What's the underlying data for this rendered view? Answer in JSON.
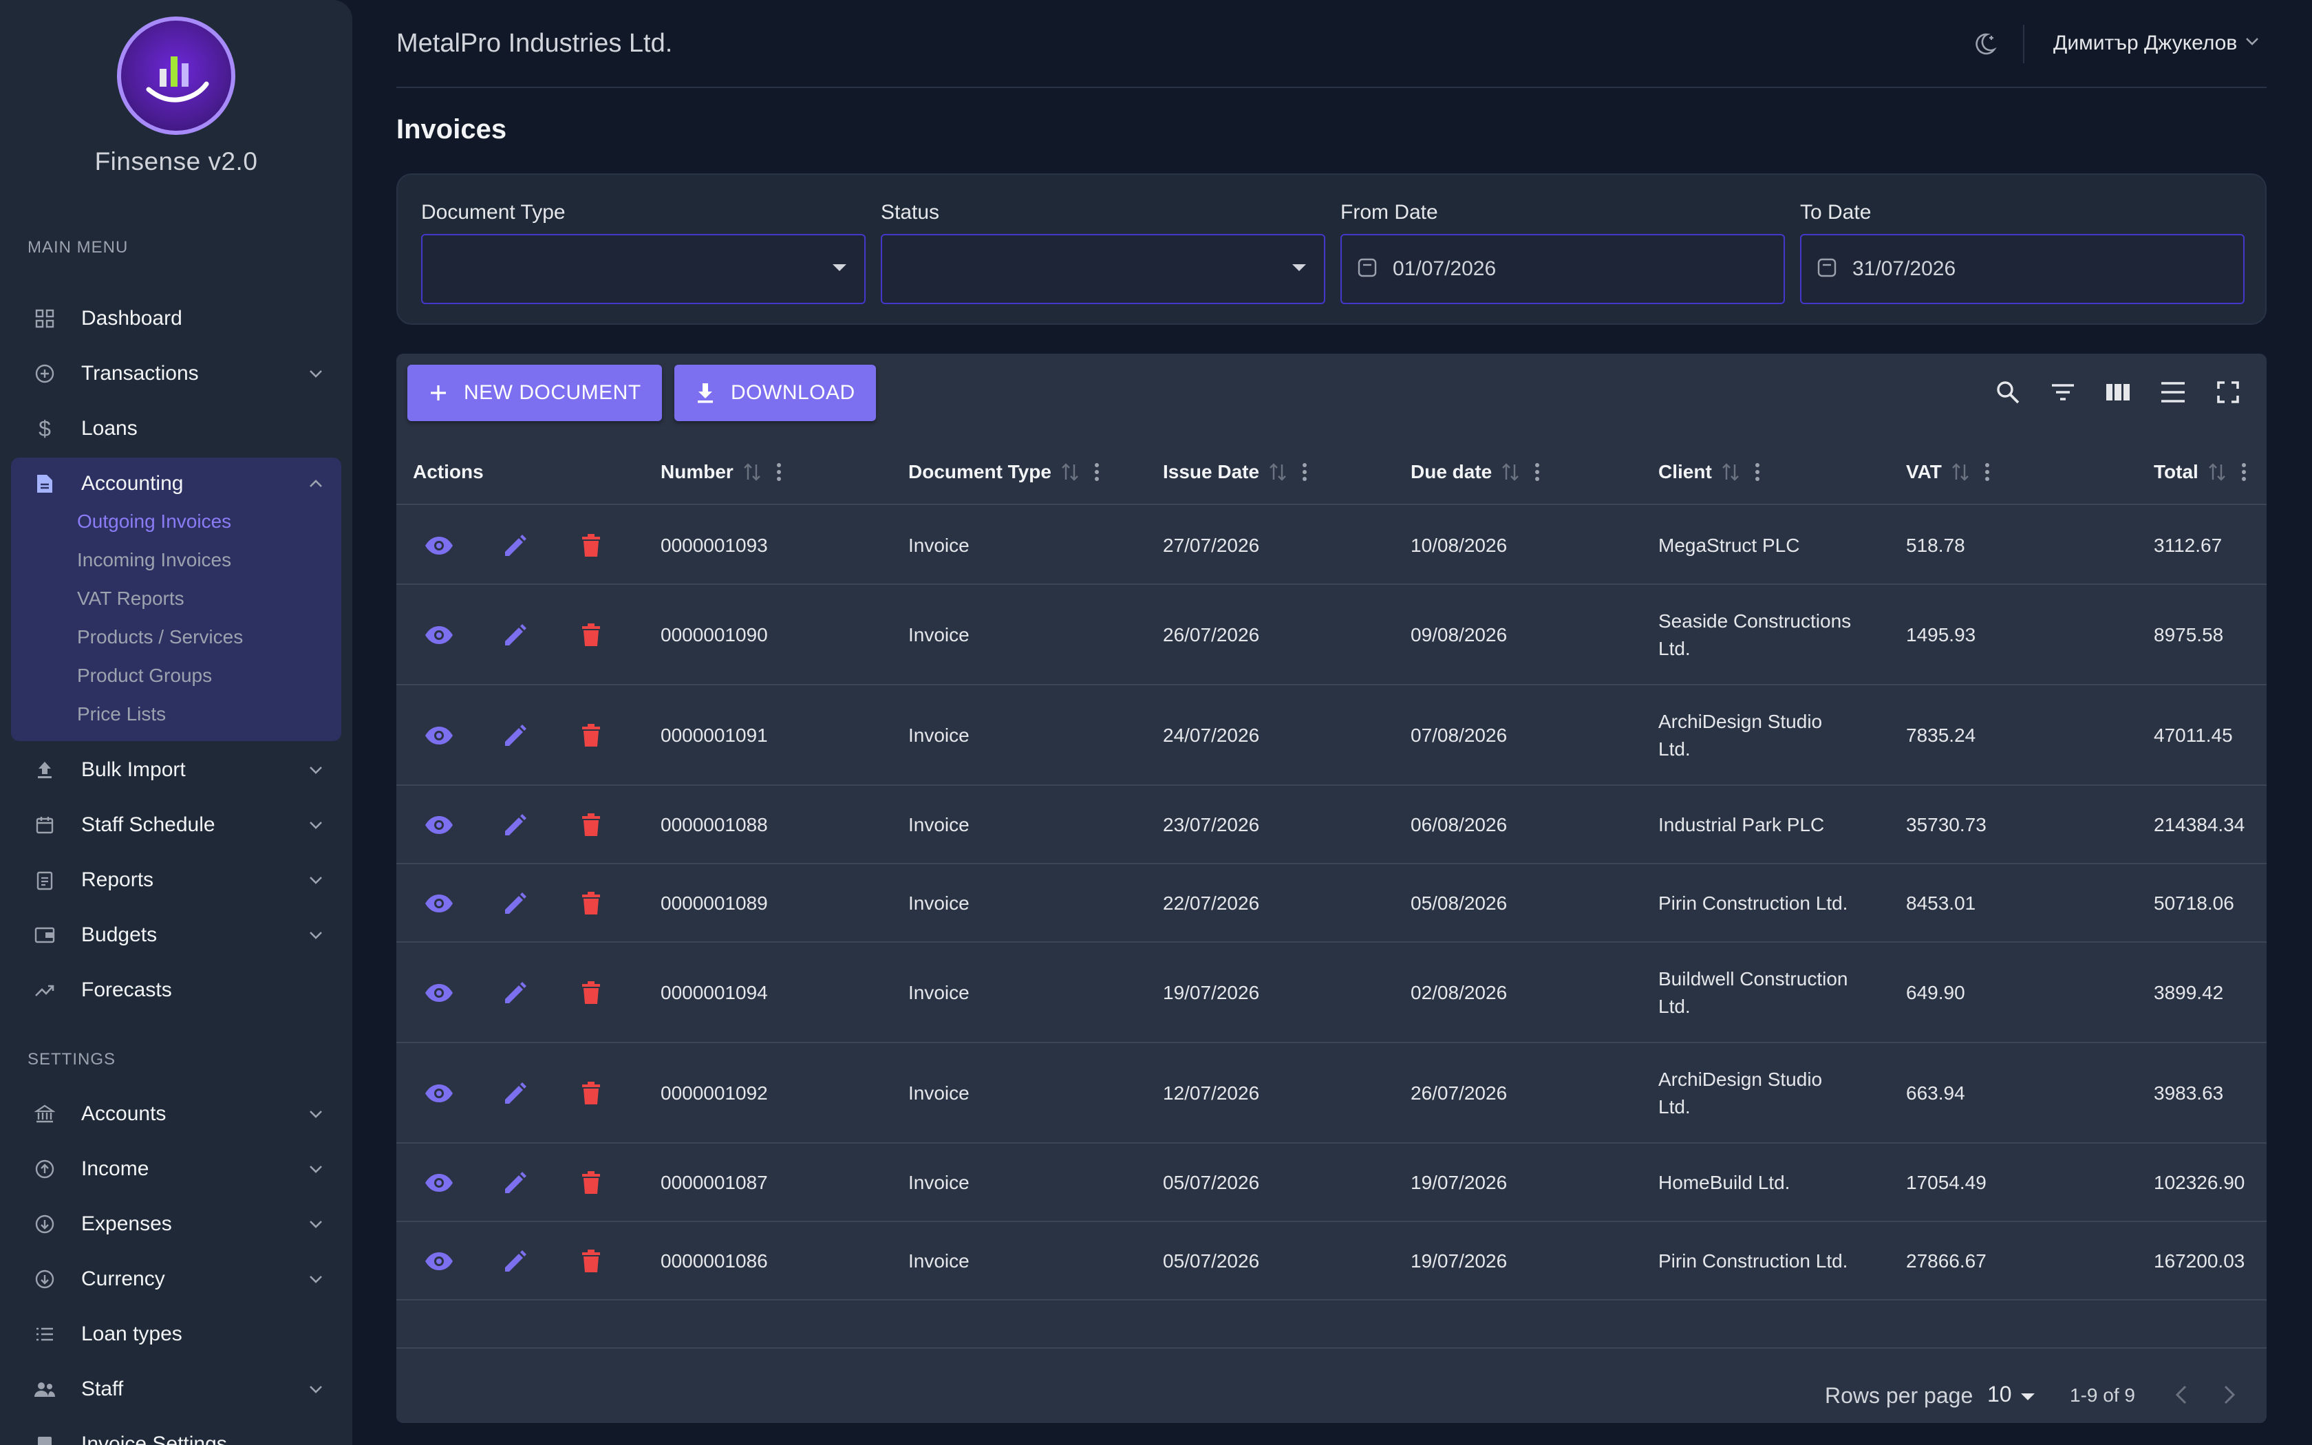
{
  "app": {
    "name": "Finsense v2.0"
  },
  "sidebar": {
    "main_menu_label": "MAIN MENU",
    "settings_label": "SETTINGS",
    "main_items": [
      {
        "label": "Dashboard",
        "icon": "grid-icon"
      },
      {
        "label": "Transactions",
        "icon": "plus-circle-icon"
      },
      {
        "label": "Loans",
        "icon": "dollar-icon"
      },
      {
        "label": "Accounting",
        "icon": "document-icon"
      },
      {
        "label": "Bulk Import",
        "icon": "upload-icon"
      },
      {
        "label": "Staff Schedule",
        "icon": "calendar-icon"
      },
      {
        "label": "Reports",
        "icon": "clipboard-icon"
      },
      {
        "label": "Budgets",
        "icon": "wallet-icon"
      },
      {
        "label": "Forecasts",
        "icon": "trending-up-icon"
      }
    ],
    "accounting_sub": [
      "Outgoing Invoices",
      "Incoming Invoices",
      "VAT Reports",
      "Products / Services",
      "Product Groups",
      "Price Lists"
    ],
    "settings_items": [
      {
        "label": "Accounts",
        "icon": "bank-icon"
      },
      {
        "label": "Income",
        "icon": "arrow-up-circle-icon"
      },
      {
        "label": "Expenses",
        "icon": "arrow-down-circle-icon"
      },
      {
        "label": "Currency",
        "icon": "currency-icon"
      },
      {
        "label": "Loan types",
        "icon": "list-icon"
      },
      {
        "label": "Staff",
        "icon": "people-icon"
      },
      {
        "label": "Invoice Settings",
        "icon": "settings-icon"
      }
    ]
  },
  "header": {
    "company": "MetalPro Industries Ltd.",
    "user": "Димитър Джукелов"
  },
  "page": {
    "title": "Invoices"
  },
  "filters": {
    "document_type": {
      "label": "Document Type",
      "value": ""
    },
    "status": {
      "label": "Status",
      "value": ""
    },
    "from_date": {
      "label": "From Date",
      "value": "01/07/2026"
    },
    "to_date": {
      "label": "To Date",
      "value": "31/07/2026"
    }
  },
  "toolbar": {
    "new_document": "NEW DOCUMENT",
    "download": "DOWNLOAD"
  },
  "table": {
    "columns": {
      "actions": "Actions",
      "number": "Number",
      "document_type": "Document Type",
      "issue_date": "Issue Date",
      "due_date": "Due date",
      "client": "Client",
      "vat": "VAT",
      "total": "Total"
    },
    "rows": [
      {
        "number": "0000001093",
        "type": "Invoice",
        "issue": "27/07/2026",
        "due": "10/08/2026",
        "client1": "MegaStruct PLC",
        "client2": "",
        "vat": "518.78",
        "total": "3112.67"
      },
      {
        "number": "0000001090",
        "type": "Invoice",
        "issue": "26/07/2026",
        "due": "09/08/2026",
        "client1": "Seaside Constructions",
        "client2": "Ltd.",
        "vat": "1495.93",
        "total": "8975.58"
      },
      {
        "number": "0000001091",
        "type": "Invoice",
        "issue": "24/07/2026",
        "due": "07/08/2026",
        "client1": "ArchiDesign Studio",
        "client2": "Ltd.",
        "vat": "7835.24",
        "total": "47011.45"
      },
      {
        "number": "0000001088",
        "type": "Invoice",
        "issue": "23/07/2026",
        "due": "06/08/2026",
        "client1": "Industrial Park PLC",
        "client2": "",
        "vat": "35730.73",
        "total": "214384.34"
      },
      {
        "number": "0000001089",
        "type": "Invoice",
        "issue": "22/07/2026",
        "due": "05/08/2026",
        "client1": "Pirin Construction Ltd.",
        "client2": "",
        "vat": "8453.01",
        "total": "50718.06"
      },
      {
        "number": "0000001094",
        "type": "Invoice",
        "issue": "19/07/2026",
        "due": "02/08/2026",
        "client1": "Buildwell Construction",
        "client2": "Ltd.",
        "vat": "649.90",
        "total": "3899.42"
      },
      {
        "number": "0000001092",
        "type": "Invoice",
        "issue": "12/07/2026",
        "due": "26/07/2026",
        "client1": "ArchiDesign Studio",
        "client2": "Ltd.",
        "vat": "663.94",
        "total": "3983.63"
      },
      {
        "number": "0000001087",
        "type": "Invoice",
        "issue": "05/07/2026",
        "due": "19/07/2026",
        "client1": "HomeBuild Ltd.",
        "client2": "",
        "vat": "17054.49",
        "total": "102326.90"
      },
      {
        "number": "0000001086",
        "type": "Invoice",
        "issue": "05/07/2026",
        "due": "19/07/2026",
        "client1": "Pirin Construction Ltd.",
        "client2": "",
        "vat": "27866.67",
        "total": "167200.03"
      }
    ]
  },
  "pagination": {
    "rows_per_page_label": "Rows per page",
    "rows_per_page": "10",
    "range": "1-9 of 9"
  },
  "colors": {
    "accent": "#7c6ff0",
    "delete": "#ef4444",
    "background": "#111827",
    "panel": "#1f2937"
  }
}
